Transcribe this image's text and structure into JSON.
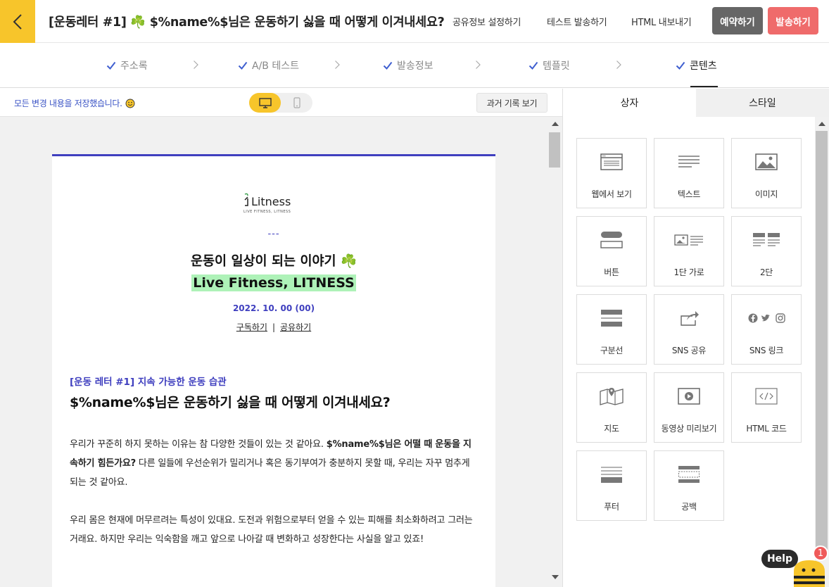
{
  "header": {
    "title": "[운동레터 #1] ☘️ $%name%$님은 운동하기 싫을 때 어떻게 이겨내세요?",
    "links": [
      "공유정보 설정하기",
      "테스트 발송하기",
      "HTML 내보내기"
    ],
    "reserve_label": "예약하기",
    "send_label": "발송하기",
    "accent": "#f7c52b"
  },
  "steps": [
    {
      "label": "주소록",
      "active": false
    },
    {
      "label": "A/B 테스트",
      "active": false
    },
    {
      "label": "발송정보",
      "active": false
    },
    {
      "label": "템플릿",
      "active": false
    },
    {
      "label": "콘텐츠",
      "active": true
    }
  ],
  "editor": {
    "saved_message": "모든 변경 내용을 저장했습니다.",
    "history_label": "과거 기록 보기"
  },
  "email": {
    "logo_text": "Litness",
    "logo_tagline": "LIVE FITNESS, LITNESS",
    "dash": "---",
    "headline": "운동이 일상이 되는 이야기 ☘️",
    "subheadline": "Live Fitness, LITNESS",
    "date": "2022. 10. 00 (00)",
    "subscribe_link": "구독하기",
    "separator": "|",
    "share_link": "공유하기",
    "series": "[운동 레터 #1] 지속 가능한 운동 습관",
    "article_title": "$%name%$님은 운동하기 싫을 때 어떻게 이겨내세요?",
    "para1_a": "우리가 꾸준히 하지 못하는 이유는 참 다양한 것들이 있는 것 같아요. ",
    "para1_b": "$%name%$님은 어떨 때 운동을 지속하기 힘든가요?",
    "para1_c": " 다른 일들에 우선순위가 밀리거나 혹은 동기부여가 충분하지 못할 때, 우리는 자꾸 멈추게 되는 것 같아요.",
    "para2": "우리 몸은 현재에 머무르려는 특성이 있대요. 도전과 위험으로부터 얻을 수 있는 피해를 최소화하려고 그러는거래요. 하지만 우리는 익숙함을 깨고 앞으로 나아갈 때 변화하고 성장한다는 사실을 알고 있죠!"
  },
  "panel": {
    "tabs": [
      "상자",
      "스타일"
    ],
    "blocks": [
      {
        "label": "웹에서 보기",
        "icon": "browser-icon"
      },
      {
        "label": "텍스트",
        "icon": "text-lines-icon"
      },
      {
        "label": "이미지",
        "icon": "image-icon"
      },
      {
        "label": "버튼",
        "icon": "button-icon"
      },
      {
        "label": "1단 가로",
        "icon": "one-column-row-icon"
      },
      {
        "label": "2단",
        "icon": "two-column-icon"
      },
      {
        "label": "구분선",
        "icon": "divider-icon"
      },
      {
        "label": "SNS 공유",
        "icon": "share-icon"
      },
      {
        "label": "SNS 링크",
        "icon": "social-links-icon"
      },
      {
        "label": "지도",
        "icon": "map-icon"
      },
      {
        "label": "동영상 미리보기",
        "icon": "video-icon"
      },
      {
        "label": "HTML 코드",
        "icon": "html-code-icon"
      },
      {
        "label": "푸터",
        "icon": "footer-icon"
      },
      {
        "label": "공백",
        "icon": "spacer-icon"
      }
    ]
  },
  "help": {
    "label": "Help",
    "badge": "1"
  }
}
